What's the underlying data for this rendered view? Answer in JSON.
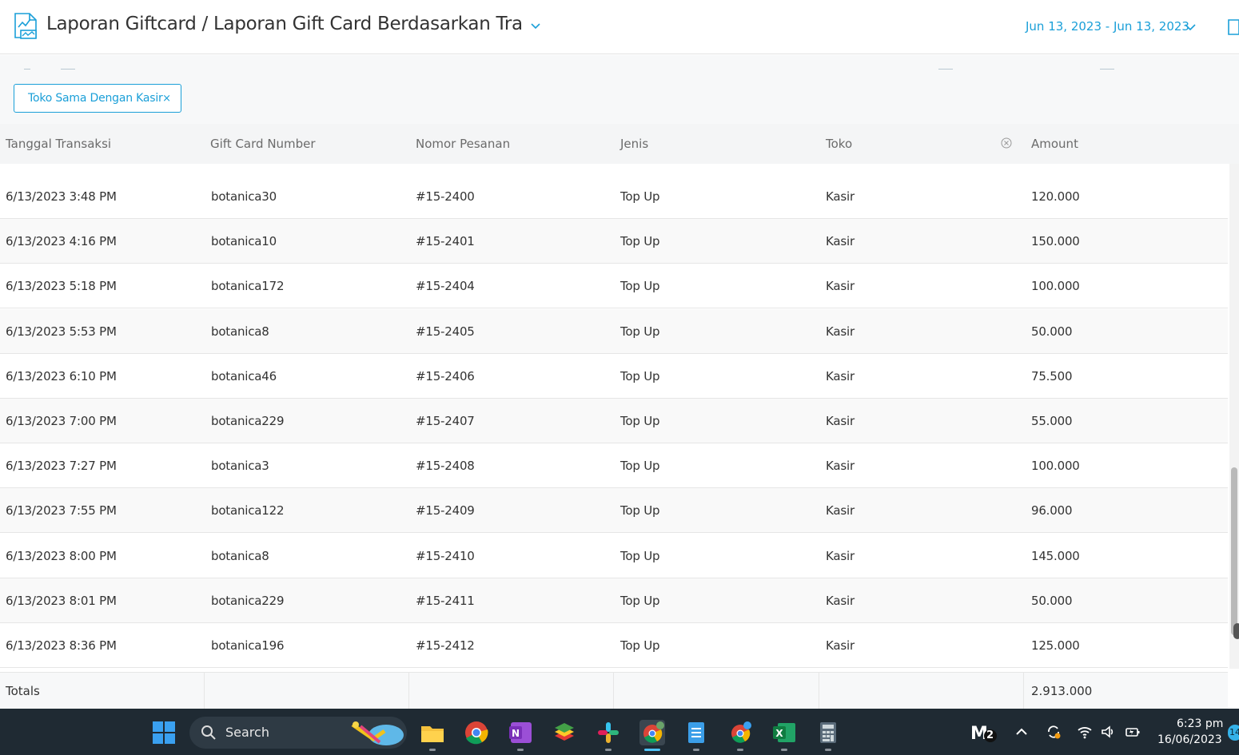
{
  "header": {
    "title": "Laporan Giftcard / Laporan Gift Card Berdasarkan Transak",
    "date_range": "Jun 13, 2023 - Jun 13, 2023"
  },
  "filter": {
    "chip_label": "Toko Sama Dengan Kasir",
    "chip_close": "×"
  },
  "table": {
    "columns": [
      "Tanggal Transaksi",
      "Gift Card Number",
      "Nomor Pesanan",
      "Jenis",
      "Toko",
      "Amount"
    ],
    "rows": [
      [
        "6/13/2023 3:48 PM",
        "botanica30",
        "#15-2400",
        "Top Up",
        "Kasir",
        "120.000"
      ],
      [
        "6/13/2023 4:16 PM",
        "botanica10",
        "#15-2401",
        "Top Up",
        "Kasir",
        "150.000"
      ],
      [
        "6/13/2023 5:18 PM",
        "botanica172",
        "#15-2404",
        "Top Up",
        "Kasir",
        "100.000"
      ],
      [
        "6/13/2023 5:53 PM",
        "botanica8",
        "#15-2405",
        "Top Up",
        "Kasir",
        "50.000"
      ],
      [
        "6/13/2023 6:10 PM",
        "botanica46",
        "#15-2406",
        "Top Up",
        "Kasir",
        "75.500"
      ],
      [
        "6/13/2023 7:00 PM",
        "botanica229",
        "#15-2407",
        "Top Up",
        "Kasir",
        "55.000"
      ],
      [
        "6/13/2023 7:27 PM",
        "botanica3",
        "#15-2408",
        "Top Up",
        "Kasir",
        "100.000"
      ],
      [
        "6/13/2023 7:55 PM",
        "botanica122",
        "#15-2409",
        "Top Up",
        "Kasir",
        "96.000"
      ],
      [
        "6/13/2023 8:00 PM",
        "botanica8",
        "#15-2410",
        "Top Up",
        "Kasir",
        "145.000"
      ],
      [
        "6/13/2023 8:01 PM",
        "botanica229",
        "#15-2411",
        "Top Up",
        "Kasir",
        "50.000"
      ],
      [
        "6/13/2023 8:36 PM",
        "botanica196",
        "#15-2412",
        "Top Up",
        "Kasir",
        "125.000"
      ]
    ],
    "totals_label": "Totals",
    "totals_value": "2.913.000"
  },
  "taskbar": {
    "search_label": "Search",
    "time": "6:23 pm",
    "date": "16/06/2023",
    "notification_count": "14",
    "m2_badge": "2"
  },
  "colors": {
    "accent": "#1a9fd8",
    "taskbar_bg": "#1f2a33"
  }
}
